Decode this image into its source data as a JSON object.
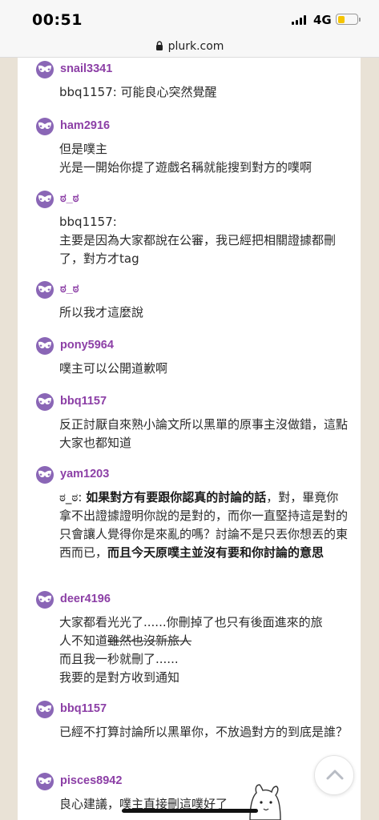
{
  "status_bar": {
    "time": "00:51",
    "network": "4G"
  },
  "browser": {
    "url": "plurk.com"
  },
  "comments": [
    {
      "user": "snail3341",
      "lines": [
        "bbq1157: 可能良心突然覺醒"
      ]
    },
    {
      "user": "ham2916",
      "lines": [
        "但是噗主",
        "光是一開始你提了遊戲名稱就能搜到對方的噗啊"
      ]
    },
    {
      "user": "ಠ_ಠ",
      "lines": [
        "bbq1157:",
        "主要是因為大家都說在公審，我已經把相關證據都刪了，對方才tag"
      ]
    },
    {
      "user": "ಠ_ಠ",
      "lines": [
        "所以我才這麼說"
      ]
    },
    {
      "user": "pony5964",
      "lines": [
        "噗主可以公開道歉啊"
      ]
    },
    {
      "user": "bbq1157",
      "lines": [
        "反正討厭自來熟小論文所以黑單的原事主沒做錯，這點大家也都知道"
      ]
    },
    {
      "user": "yam1203",
      "segments": [
        {
          "text": "ಠ_ಠ: ",
          "bold": false
        },
        {
          "text": "如果對方有要跟你認真的討論的話",
          "bold": true
        },
        {
          "text": "，對，畢竟你拿不出證據證明你說的是對的，而你一直堅持這是對的只會讓人覺得你是來亂的嗎？討論不是只丟你想丟的東西而已，",
          "bold": false
        },
        {
          "text": "而且今天原噗主並沒有要和你討論的意思",
          "bold": true
        }
      ]
    },
    {
      "user": "deer4196",
      "line1": "大家都看光光了......你刪掉了也只有後面進來的旅",
      "line2_plain": "人不知道",
      "line2_strike": "雖然也沒新旅人",
      "line3": "而且我一秒就刪了......",
      "line4": "我要的是對方收到通知"
    },
    {
      "user": "bbq1157",
      "lines": [
        "已經不打算討論所以黑單你，不放過對方的到底是誰？"
      ]
    },
    {
      "user": "pisces8942",
      "lines": [
        "良心建議，噗主直接刪這噗好了"
      ]
    }
  ],
  "colors": {
    "username": "#8c3fa6",
    "avatar": "#8a66b6",
    "background": "#e9e2d6"
  },
  "icons": [
    "lock-icon",
    "mask-avatar-icon",
    "chevron-up-icon",
    "signal-icon",
    "battery-icon",
    "mascot-icon"
  ]
}
